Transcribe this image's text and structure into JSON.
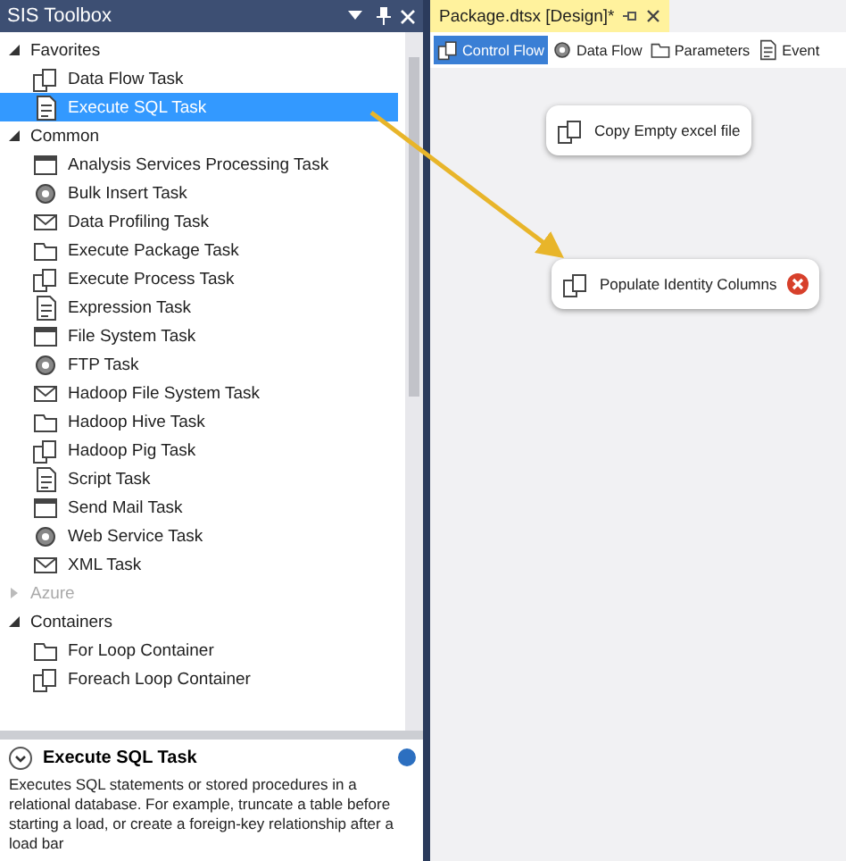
{
  "toolbox": {
    "title": "SIS Toolbox",
    "sections": [
      {
        "name": "Favorites",
        "expanded": true,
        "disabled": false,
        "items": [
          {
            "label": "Data Flow Task",
            "selected": false
          },
          {
            "label": "Execute SQL Task",
            "selected": true
          }
        ]
      },
      {
        "name": "Common",
        "expanded": true,
        "disabled": false,
        "items": [
          {
            "label": "Analysis Services Processing Task",
            "selected": false
          },
          {
            "label": "Bulk Insert Task",
            "selected": false
          },
          {
            "label": "Data Profiling Task",
            "selected": false
          },
          {
            "label": "Execute Package Task",
            "selected": false
          },
          {
            "label": "Execute Process Task",
            "selected": false
          },
          {
            "label": "Expression Task",
            "selected": false
          },
          {
            "label": "File System Task",
            "selected": false
          },
          {
            "label": "FTP Task",
            "selected": false
          },
          {
            "label": "Hadoop File System Task",
            "selected": false
          },
          {
            "label": "Hadoop Hive Task",
            "selected": false
          },
          {
            "label": "Hadoop Pig Task",
            "selected": false
          },
          {
            "label": "Script Task",
            "selected": false
          },
          {
            "label": "Send Mail Task",
            "selected": false
          },
          {
            "label": "Web Service Task",
            "selected": false
          },
          {
            "label": "XML Task",
            "selected": false
          }
        ]
      },
      {
        "name": "Azure",
        "expanded": false,
        "disabled": true
      },
      {
        "name": "Containers",
        "expanded": true,
        "disabled": false,
        "items": [
          {
            "label": "For Loop Container",
            "selected": false
          },
          {
            "label": "Foreach Loop Container",
            "selected": false
          }
        ]
      }
    ],
    "description": {
      "title": "Execute SQL Task",
      "text": "Executes SQL statements or stored procedures in a relational database. For example, truncate a table before starting a load, or create a foreign-key relationship after a load bar"
    }
  },
  "designer": {
    "tab": {
      "title": "Package.dtsx [Design]*"
    },
    "tabs": [
      {
        "label": "Control Flow",
        "selected": true
      },
      {
        "label": "Data Flow",
        "selected": false
      },
      {
        "label": "Parameters",
        "selected": false
      },
      {
        "label": "Event",
        "selected": false
      }
    ],
    "nodes": [
      {
        "label": "Copy Empty excel file",
        "error": false
      },
      {
        "label": "Populate Identity Columns",
        "error": true
      }
    ]
  }
}
